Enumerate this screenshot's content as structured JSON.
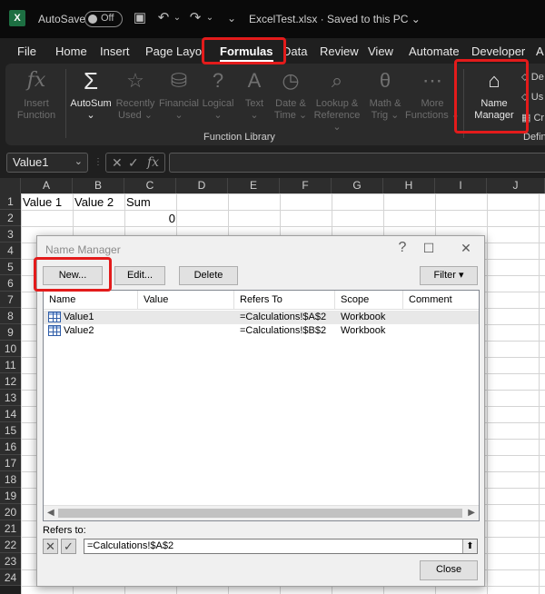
{
  "titlebar": {
    "logo": "X",
    "autosave_label": "AutoSave",
    "autosave_state": "Off",
    "filename": "ExcelTest.xlsx  ·  Saved to this PC ⌄",
    "icons": [
      "save-icon",
      "undo-icon",
      "redo-icon",
      "more-icon"
    ]
  },
  "menu": {
    "tabs": [
      "File",
      "Home",
      "Insert",
      "Page Layout",
      "Formulas",
      "Data",
      "Review",
      "View",
      "Automate",
      "Developer",
      "A"
    ],
    "active": "Formulas"
  },
  "ribbon": {
    "buttons": [
      {
        "label1": "Insert",
        "label2": "Function",
        "icon": "fx-icon",
        "glyph": "𝑓x",
        "enabled": false
      },
      {
        "label1": "AutoSum",
        "label2": "⌄",
        "icon": "sigma-icon",
        "glyph": "Σ",
        "enabled": true
      },
      {
        "label1": "Recently",
        "label2": "Used ⌄",
        "icon": "star-book-icon",
        "glyph": "☆",
        "enabled": false
      },
      {
        "label1": "Financial",
        "label2": "⌄",
        "icon": "coins-icon",
        "glyph": "⛁",
        "enabled": false
      },
      {
        "label1": "Logical",
        "label2": "⌄",
        "icon": "question-book-icon",
        "glyph": "?",
        "enabled": false
      },
      {
        "label1": "Text",
        "label2": "⌄",
        "icon": "text-book-icon",
        "glyph": "A",
        "enabled": false
      },
      {
        "label1": "Date &",
        "label2": "Time ⌄",
        "icon": "clock-icon",
        "glyph": "◷",
        "enabled": false
      },
      {
        "label1": "Lookup &",
        "label2": "Reference ⌄",
        "icon": "magnifier-book-icon",
        "glyph": "⌕",
        "enabled": false
      },
      {
        "label1": "Math &",
        "label2": "Trig ⌄",
        "icon": "theta-book-icon",
        "glyph": "θ",
        "enabled": false
      },
      {
        "label1": "More",
        "label2": "Functions ⌄",
        "icon": "more-functions-icon",
        "glyph": "⋯",
        "enabled": false
      },
      {
        "label1": "Name",
        "label2": "Manager",
        "icon": "name-tag-icon",
        "glyph": "⌂",
        "enabled": true
      }
    ],
    "group_label": "Function Library",
    "side_items": [
      "De",
      "Us",
      "Cr"
    ],
    "side_group_label": "Defin"
  },
  "formula_bar": {
    "name_box": "Value1",
    "fx": "fx"
  },
  "sheet": {
    "columns": [
      "A",
      "B",
      "C",
      "D",
      "E",
      "F",
      "G",
      "H",
      "I",
      "J"
    ],
    "rows": [
      "1",
      "2",
      "3",
      "4",
      "5",
      "6",
      "7",
      "8",
      "9",
      "10",
      "11",
      "12",
      "13",
      "14",
      "15",
      "16",
      "17",
      "18",
      "19",
      "20",
      "21",
      "22",
      "23",
      "24"
    ],
    "cells": {
      "A1": "Value 1",
      "B1": "Value 2",
      "C1": "Sum",
      "C2": "0"
    }
  },
  "dialog": {
    "title": "Name Manager",
    "buttons": {
      "new": "New...",
      "edit": "Edit...",
      "delete": "Delete",
      "filter": "Filter ▾",
      "close": "Close"
    },
    "columns": [
      "Name",
      "Value",
      "Refers To",
      "Scope",
      "Comment"
    ],
    "rows": [
      {
        "name": "Value1",
        "value": "",
        "refers_to": "=Calculations!$A$2",
        "scope": "Workbook",
        "comment": ""
      },
      {
        "name": "Value2",
        "value": "",
        "refers_to": "=Calculations!$B$2",
        "scope": "Workbook",
        "comment": ""
      }
    ],
    "refers_label": "Refers to:",
    "refers_value": "=Calculations!$A$2"
  }
}
